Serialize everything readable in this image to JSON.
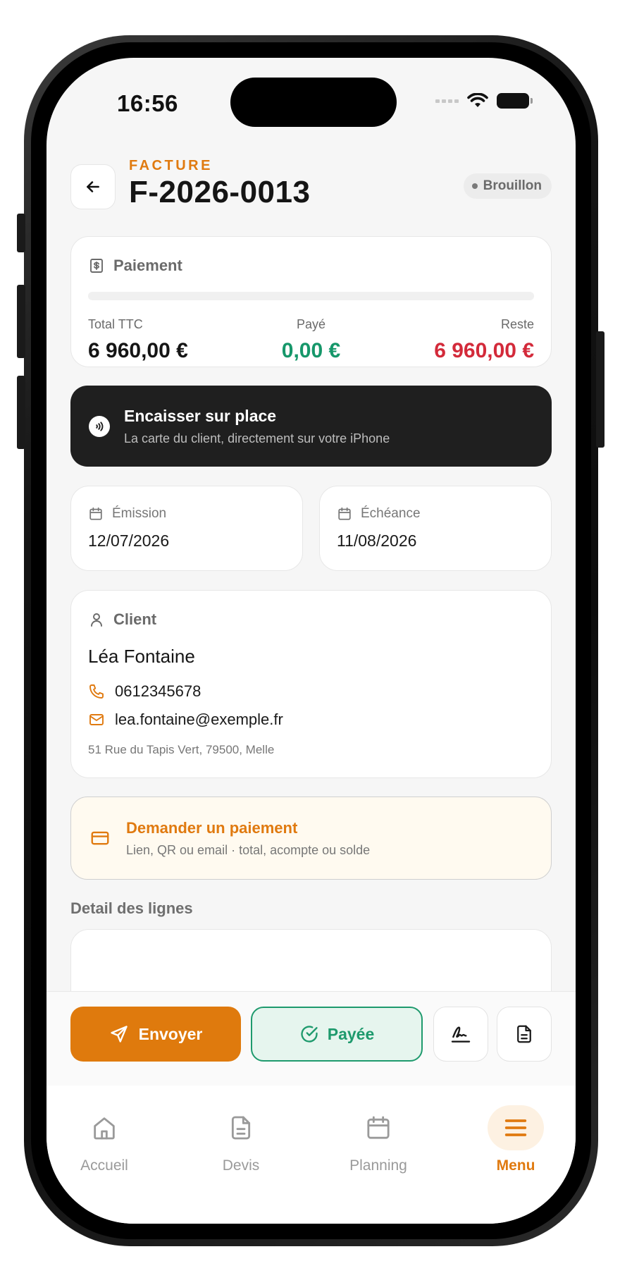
{
  "status_bar": {
    "time": "16:56"
  },
  "header": {
    "kicker": "FACTURE",
    "title": "F-2026-0013",
    "status": "Brouillon"
  },
  "payment": {
    "heading": "Paiement",
    "total_label": "Total TTC",
    "total_value": "6 960,00 €",
    "paid_label": "Payé",
    "paid_value": "0,00 €",
    "rest_label": "Reste",
    "rest_value": "6 960,00 €",
    "progress": 0
  },
  "tap_to_pay": {
    "title": "Encaisser sur place",
    "subtitle": "La carte du client, directement sur votre iPhone"
  },
  "dates": {
    "issue_label": "Émission",
    "issue_value": "12/07/2026",
    "due_label": "Échéance",
    "due_value": "11/08/2026"
  },
  "client": {
    "heading": "Client",
    "name": "Léa Fontaine",
    "phone": "0612345678",
    "email": "lea.fontaine@exemple.fr",
    "address": "51 Rue du Tapis Vert, 79500, Melle"
  },
  "payment_request": {
    "title": "Demander un paiement",
    "subtitle": "Lien, QR ou email · total, acompte ou solde"
  },
  "lines": {
    "heading": "Detail des lignes"
  },
  "actions": {
    "send_label": "Envoyer",
    "paid_label": "Payée"
  },
  "tabs": [
    {
      "label": "Accueil",
      "icon": "home-icon"
    },
    {
      "label": "Devis",
      "icon": "document-icon"
    },
    {
      "label": "Planning",
      "icon": "calendar-icon"
    },
    {
      "label": "Menu",
      "icon": "menu-icon",
      "active": true
    }
  ],
  "colors": {
    "accent": "#df7a0d",
    "success": "#1e9a6d",
    "danger": "#d32a3a",
    "dark_banner": "#1f1f1f"
  }
}
